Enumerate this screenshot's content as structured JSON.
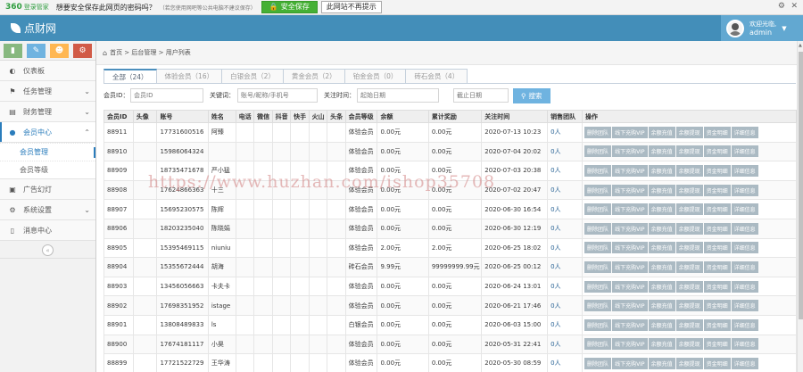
{
  "pwbar": {
    "logo": "360",
    "logo_sub": "登录管家",
    "question": "想要安全保存此网页的密码吗？",
    "note": "（若您使用网吧等公共电脑不建议保存）",
    "save_label": "安全保存",
    "never_label": "此网站不再提示"
  },
  "header": {
    "brand": "点财网",
    "welcome": "欢迎光临,",
    "username": "admin"
  },
  "sidebar": {
    "shortcut_colors": [
      "#87b87f",
      "#6fb3e0",
      "#ffb752",
      "#d15b47"
    ],
    "items": [
      {
        "label": "仪表板",
        "icon": "dashboard-icon"
      },
      {
        "label": "任务管理",
        "icon": "flag-icon"
      },
      {
        "label": "财务管理",
        "icon": "list-icon"
      },
      {
        "label": "会员中心",
        "icon": "user-icon"
      },
      {
        "label": "广告幻灯",
        "icon": "picture-icon"
      },
      {
        "label": "系统设置",
        "icon": "cog-icon"
      },
      {
        "label": "消息中心",
        "icon": "bookmark-icon"
      }
    ],
    "sub_items": [
      {
        "label": "会员管理"
      },
      {
        "label": "会员等级"
      }
    ]
  },
  "breadcrumb": {
    "home": "首页",
    "level2": "后台管理",
    "level3": "用户列表"
  },
  "tabs": [
    {
      "label": "全部（24）"
    },
    {
      "label": "体验会员（16）"
    },
    {
      "label": "白银会员（2）"
    },
    {
      "label": "黄金会员（2）"
    },
    {
      "label": "铂金会员（0）"
    },
    {
      "label": "砖石会员（4）"
    }
  ],
  "filters": {
    "member_id_label": "会员ID：",
    "member_id_placeholder": "会员ID",
    "keyword_label": "关键词：",
    "keyword_placeholder": "账号/昵称/手机号",
    "time_label": "关注时间：",
    "start_placeholder": "起始日期",
    "end_placeholder": "截止日期",
    "search_label": "搜索"
  },
  "table": {
    "columns": [
      "会员ID",
      "头像",
      "账号",
      "姓名",
      "电话",
      "微信",
      "抖音",
      "快手",
      "火山",
      "头条",
      "会员等级",
      "余额",
      "累计奖励",
      "关注时间",
      "销售团队",
      "操作"
    ],
    "op_buttons": [
      "删除团队",
      "线下充购VIP",
      "余额充值",
      "余额提现",
      "资金明细",
      "详细信息"
    ],
    "rows": [
      {
        "id": "88911",
        "account": "17731600516",
        "name": "阿臻",
        "level": "体验会员",
        "balance": "0.00元",
        "reward": "0.00元",
        "time": "2020-07-13 10:23",
        "team": "0人"
      },
      {
        "id": "88910",
        "account": "15986064324",
        "name": "",
        "level": "体验会员",
        "balance": "0.00元",
        "reward": "0.00元",
        "time": "2020-07-04 20:02",
        "team": "0人"
      },
      {
        "id": "88909",
        "account": "18735471678",
        "name": "严小猛",
        "level": "体验会员",
        "balance": "0.00元",
        "reward": "0.00元",
        "time": "2020-07-03 20:38",
        "team": "0人"
      },
      {
        "id": "88908",
        "account": "17624866363",
        "name": "十三",
        "level": "体验会员",
        "balance": "0.00元",
        "reward": "0.00元",
        "time": "2020-07-02 20:47",
        "team": "0人"
      },
      {
        "id": "88907",
        "account": "15695230575",
        "name": "陈辉",
        "level": "体验会员",
        "balance": "0.00元",
        "reward": "0.00元",
        "time": "2020-06-30 16:54",
        "team": "0人"
      },
      {
        "id": "88906",
        "account": "18203235040",
        "name": "陈晓娟",
        "level": "体验会员",
        "balance": "0.00元",
        "reward": "0.00元",
        "time": "2020-06-30 12:19",
        "team": "0人"
      },
      {
        "id": "88905",
        "account": "15395469115",
        "name": "niuniu",
        "level": "体验会员",
        "balance": "2.00元",
        "reward": "2.00元",
        "time": "2020-06-25 18:02",
        "team": "0人"
      },
      {
        "id": "88904",
        "account": "15355672444",
        "name": "胡海",
        "level": "砖石会员",
        "balance": "9.99元",
        "reward": "99999999.99元",
        "time": "2020-06-25 00:12",
        "team": "0人"
      },
      {
        "id": "88903",
        "account": "13456056663",
        "name": "卡夫卡",
        "level": "体验会员",
        "balance": "0.00元",
        "reward": "0.00元",
        "time": "2020-06-24 13:01",
        "team": "0人"
      },
      {
        "id": "88902",
        "account": "17698351952",
        "name": "istage",
        "level": "体验会员",
        "balance": "0.00元",
        "reward": "0.00元",
        "time": "2020-06-21 17:46",
        "team": "0人"
      },
      {
        "id": "88901",
        "account": "13808489833",
        "name": "ls",
        "level": "白银会员",
        "balance": "0.00元",
        "reward": "0.00元",
        "time": "2020-06-03 15:00",
        "team": "0人"
      },
      {
        "id": "88900",
        "account": "17674181117",
        "name": "小昊",
        "level": "体验会员",
        "balance": "0.00元",
        "reward": "0.00元",
        "time": "2020-05-31 22:41",
        "team": "0人"
      },
      {
        "id": "88899",
        "account": "17721522729",
        "name": "王华涛",
        "level": "体验会员",
        "balance": "0.00元",
        "reward": "0.00元",
        "time": "2020-05-30 08:59",
        "team": "0人"
      }
    ]
  },
  "watermark": "https://www.huzhan.com/ishop35708"
}
